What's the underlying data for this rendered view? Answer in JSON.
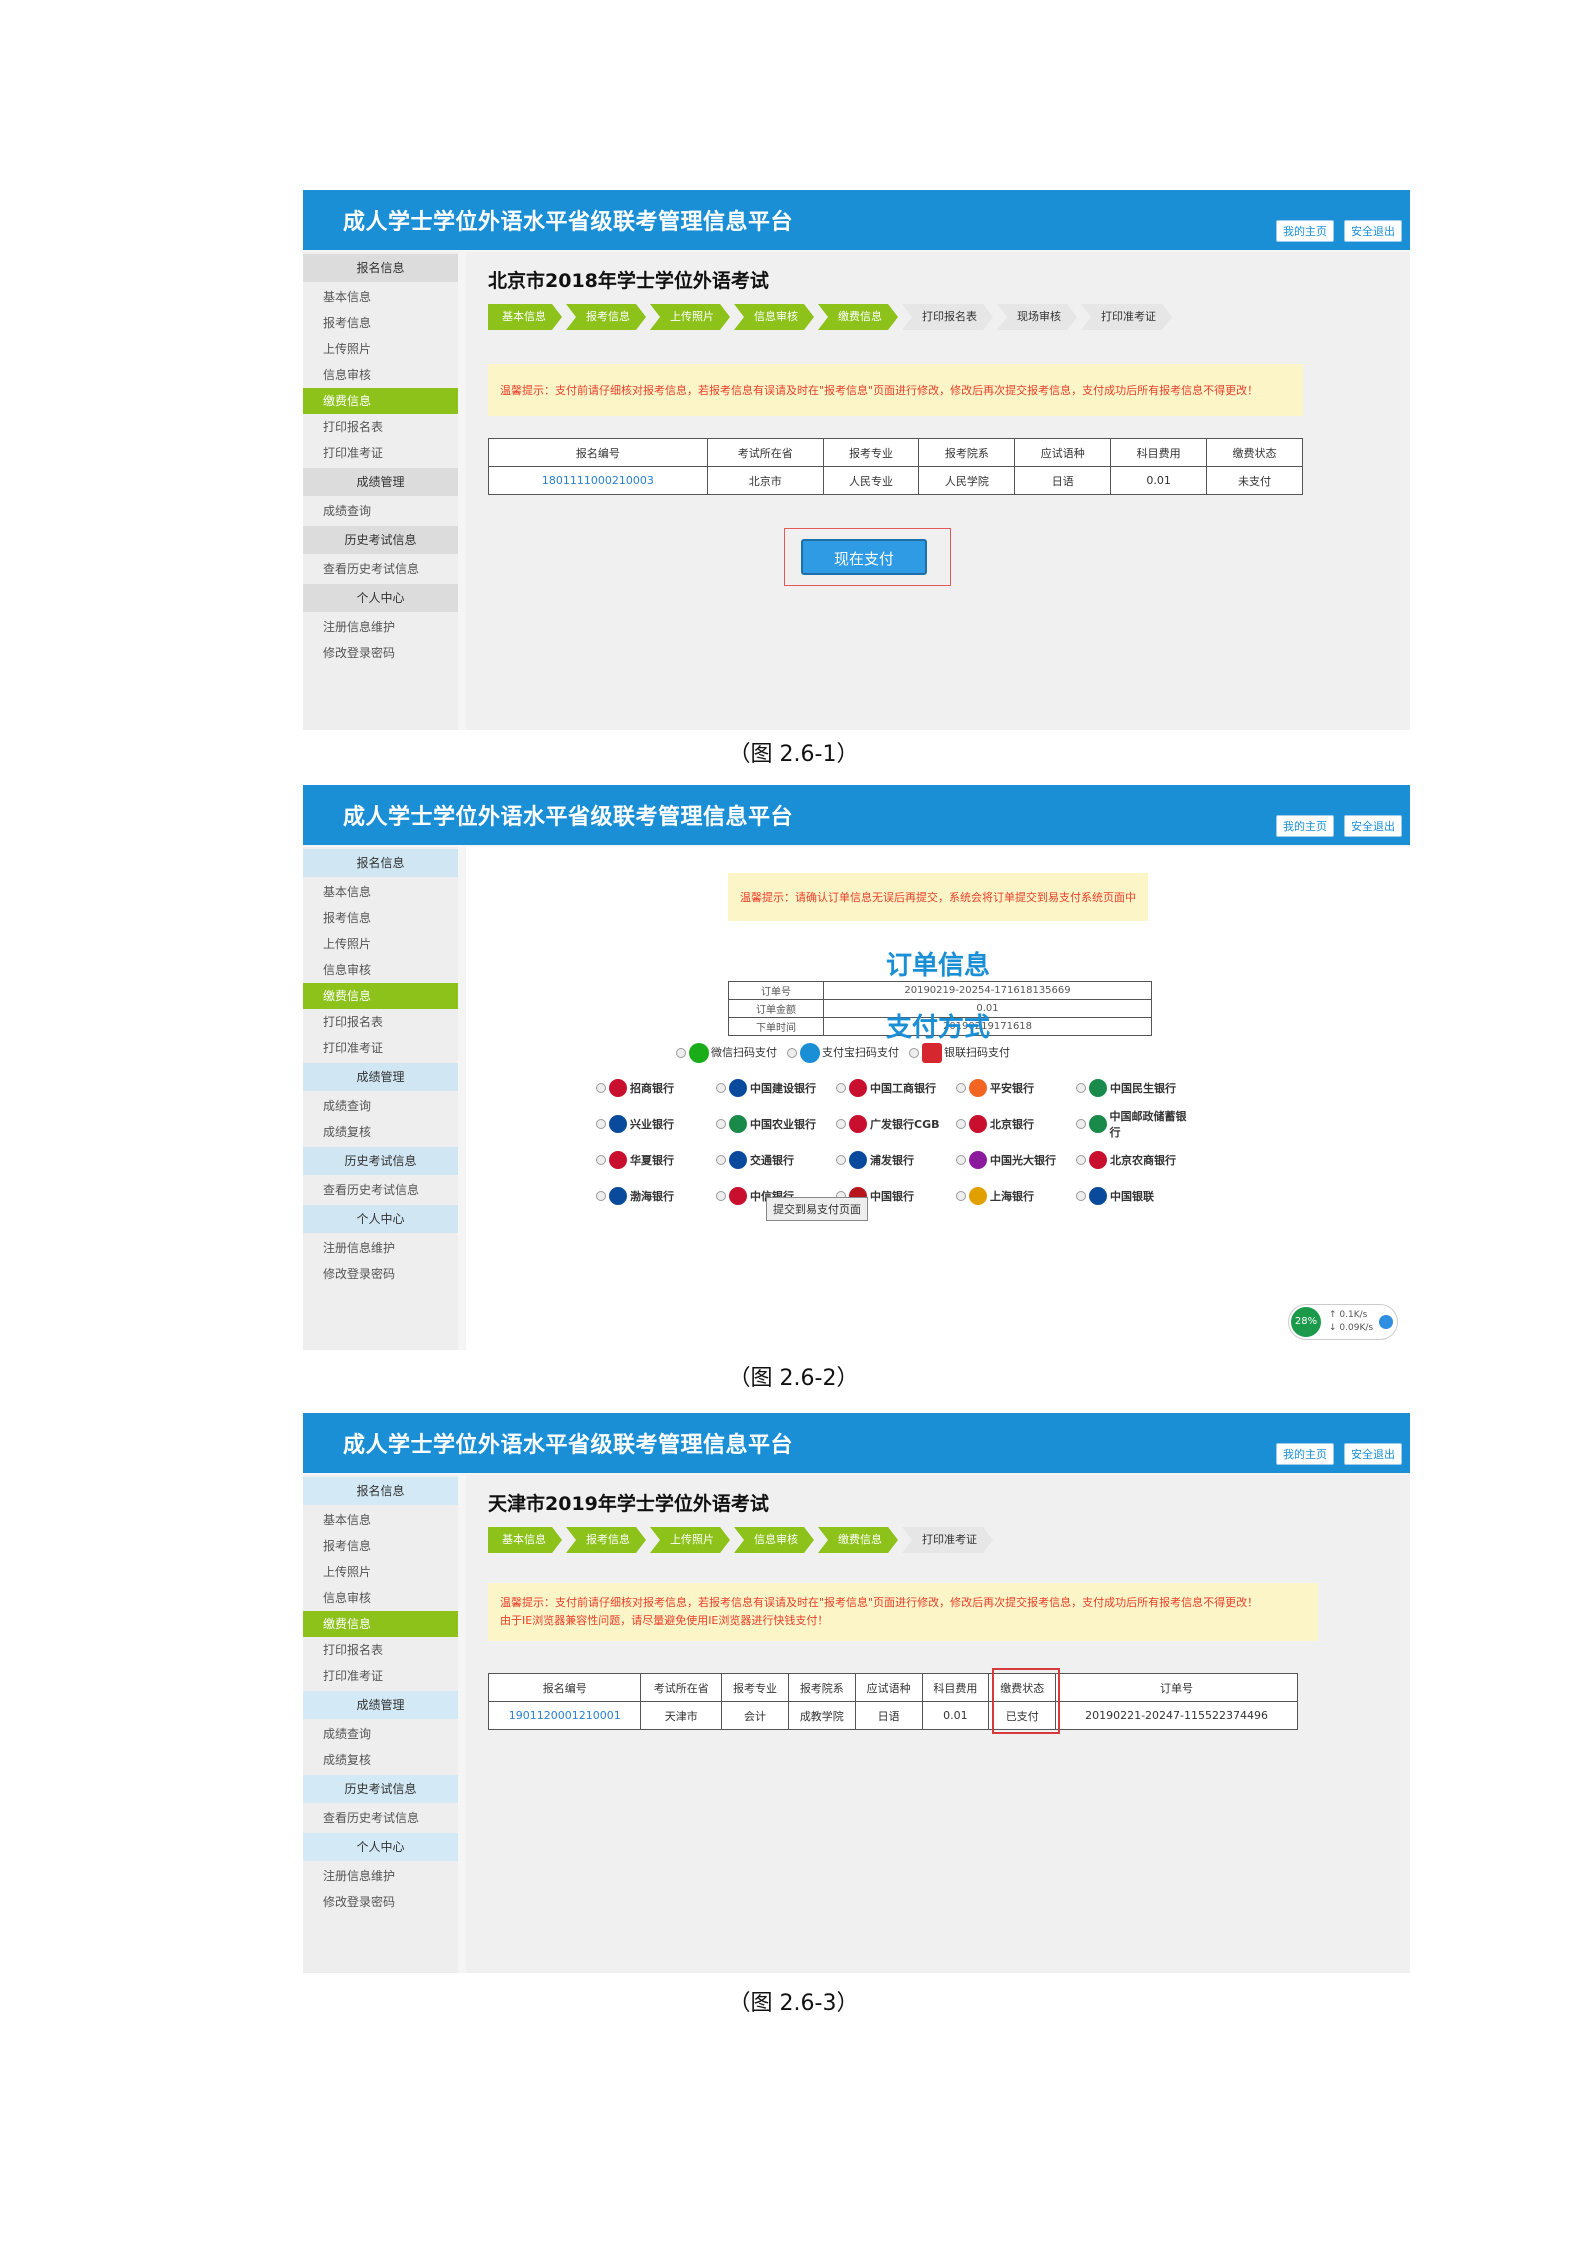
{
  "header": {
    "title": "成人学士学位外语水平省级联考管理信息平台",
    "home_btn": "我的主页",
    "logout_btn": "安全退出"
  },
  "sidebar": {
    "sec_baoming": "报名信息",
    "items_baoming": [
      "基本信息",
      "报考信息",
      "上传照片",
      "信息审核",
      "缴费信息",
      "打印报名表",
      "打印准考证"
    ],
    "sec_chengji": "成绩管理",
    "item_chengji_query": "成绩查询",
    "item_chengji_review": "成绩复核",
    "sec_history": "历史考试信息",
    "item_history": "查看历史考试信息",
    "sec_personal": "个人中心",
    "item_register": "注册信息维护",
    "item_password": "修改登录密码"
  },
  "fig1": {
    "exam_title": "北京市2018年学士学位外语考试",
    "steps": [
      "基本信息",
      "报考信息",
      "上传照片",
      "信息审核",
      "缴费信息",
      "打印报名表",
      "现场审核",
      "打印准考证"
    ],
    "tip": "温馨提示：支付前请仔细核对报考信息，若报考信息有误请及时在\"报考信息\"页面进行修改，修改后再次提交报考信息，支付成功后所有报考信息不得更改！",
    "headers": [
      "报名编号",
      "考试所在省",
      "报考专业",
      "报考院系",
      "应试语种",
      "科目费用",
      "缴费状态"
    ],
    "row": [
      "1801111000210003",
      "北京市",
      "人民专业",
      "人民学院",
      "日语",
      "0.01",
      "未支付"
    ],
    "pay_button": "现在支付",
    "caption": "（图 2.6-1）"
  },
  "fig2": {
    "tip": "温馨提示：请确认订单信息无误后再提交，系统会将订单提交到易支付系统页面中",
    "order_heading": "订单信息",
    "order_rows": [
      {
        "label": "订单号",
        "value": "20190219-20254-171618135669"
      },
      {
        "label": "订单金额",
        "value": "0.01"
      },
      {
        "label": "下单时间",
        "value": "20190219171618"
      }
    ],
    "pay_heading": "支付方式",
    "pay_types": [
      "微信扫码支付",
      "支付宝扫码支付",
      "银联扫码支付"
    ],
    "banks": [
      "招商银行",
      "中国建设银行",
      "中国工商银行",
      "平安银行",
      "中国民生银行",
      "兴业银行",
      "中国农业银行",
      "广发银行CGB",
      "北京银行",
      "中国邮政储蓄银行",
      "华夏银行",
      "交通银行",
      "浦发银行",
      "中国光大银行",
      "北京农商银行",
      "渤海银行",
      "中信银行",
      "中国银行",
      "上海银行",
      "中国银联"
    ],
    "bank_colors": [
      "#c8102e",
      "#0a4a9c",
      "#c8102e",
      "#f26522",
      "#1a8a4a",
      "#0a4a9c",
      "#1a8a4a",
      "#c8102e",
      "#c8102e",
      "#1a8a4a",
      "#c8102e",
      "#0a4a9c",
      "#0a4a9c",
      "#8b1a9c",
      "#c8102e",
      "#0a4a9c",
      "#c8102e",
      "#b8141b",
      "#e0a000",
      "#0a4a9c"
    ],
    "submit": "提交到易支付页面",
    "net_pct": "28%",
    "net_up": "↑ 0.1K/s",
    "net_down": "↓ 0.09K/s",
    "caption": "（图 2.6-2）"
  },
  "fig3": {
    "exam_title": "天津市2019年学士学位外语考试",
    "steps": [
      "基本信息",
      "报考信息",
      "上传照片",
      "信息审核",
      "缴费信息",
      "打印准考证"
    ],
    "tip_line1": "温馨提示：支付前请仔细核对报考信息，若报考信息有误请及时在\"报考信息\"页面进行修改，修改后再次提交报考信息，支付成功后所有报考信息不得更改！",
    "tip_line2": "由于IE浏览器兼容性问题，请尽量避免使用IE浏览器进行快钱支付！",
    "headers": [
      "报名编号",
      "考试所在省",
      "报考专业",
      "报考院系",
      "应试语种",
      "科目费用",
      "缴费状态",
      "订单号"
    ],
    "row": [
      "1901120001210001",
      "天津市",
      "会计",
      "成教学院",
      "日语",
      "0.01",
      "已支付",
      "20190221-20247-115522374496"
    ],
    "caption": "（图 2.6-3）"
  }
}
